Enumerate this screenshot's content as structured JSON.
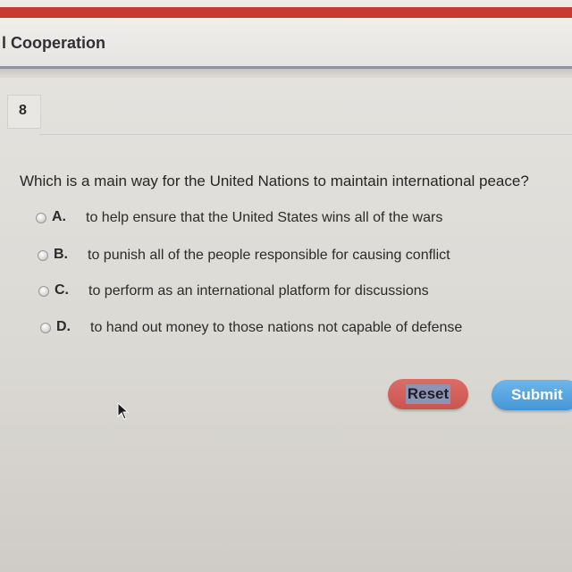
{
  "header": {
    "title": "l Cooperation"
  },
  "question": {
    "number": "8",
    "text": "Which is a main way for the United Nations to maintain international peace?",
    "options": [
      {
        "letter": "A.",
        "text": "to help ensure that the United States wins all of the wars"
      },
      {
        "letter": "B.",
        "text": "to punish all of the people responsible for causing conflict"
      },
      {
        "letter": "C.",
        "text": "to perform as an international platform for discussions"
      },
      {
        "letter": "D.",
        "text": "to hand out money to those nations not capable of defense"
      }
    ]
  },
  "buttons": {
    "reset_label": "Reset",
    "submit_label": "Submit"
  },
  "colors": {
    "brand_red": "#c63a34",
    "reset_button": "#d65f59",
    "submit_button": "#56a6df",
    "header_rule": "#8f92a2"
  }
}
